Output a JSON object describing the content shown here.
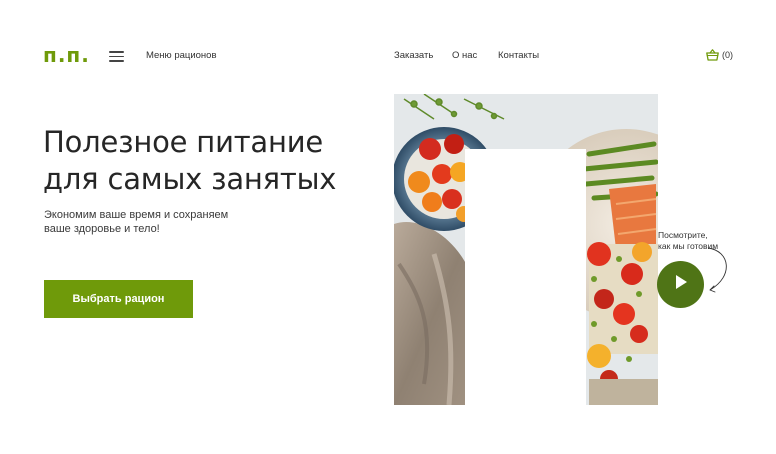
{
  "header": {
    "logo": "п.п.",
    "menu_link": "Меню рационов",
    "nav": [
      "Заказать",
      "О нас",
      "Контакты"
    ],
    "cart_count": "(0)"
  },
  "hero": {
    "headline_line1": "Полезное питание",
    "headline_line2": "для самых занятых",
    "subtitle_line1": "Экономим ваше время и сохраняем",
    "subtitle_line2": "ваше здоровье и тело!",
    "cta_label": "Выбрать рацион",
    "image_alt": "food-bowls-photo"
  },
  "video": {
    "caption_line1": "Посмотрите,",
    "caption_line2": "как мы готовим"
  },
  "icons": {
    "menu": "hamburger-icon",
    "cart": "basket-icon",
    "play": "play-icon",
    "arrow": "curved-arrow-icon"
  },
  "colors": {
    "brand_green": "#6f9a0a",
    "play_green": "#4f7416",
    "text_dark": "#262626"
  }
}
